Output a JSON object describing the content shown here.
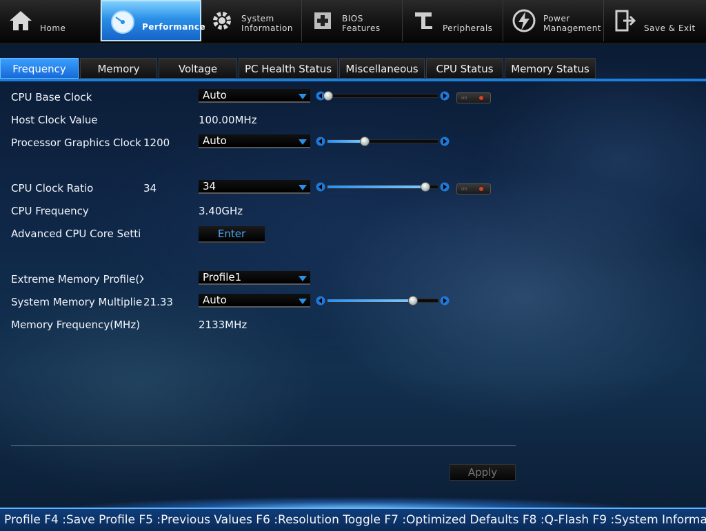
{
  "topnav": {
    "items": [
      {
        "label": "Home",
        "icon": "house-icon"
      },
      {
        "label": "Performance",
        "icon": "gauge-icon",
        "active": true
      },
      {
        "label": "System\nInformation",
        "icon": "gear-icon"
      },
      {
        "label": "BIOS\nFeatures",
        "icon": "chip-plus-icon"
      },
      {
        "label": "Peripherals",
        "icon": "connector-icon"
      },
      {
        "label": "Power\nManagement",
        "icon": "power-bolt-icon"
      },
      {
        "label": "Save & Exit",
        "icon": "exit-door-icon"
      }
    ]
  },
  "tabs": [
    "Frequency",
    "Memory",
    "Voltage",
    "PC Health Status",
    "Miscellaneous",
    "CPU Status",
    "Memory Status"
  ],
  "active_tab": "Frequency",
  "rows": {
    "cpu_base_clock": {
      "label": "CPU Base Clock",
      "dropdown": "Auto",
      "slider_fraction": 0.0,
      "toggle": "off"
    },
    "host_clock": {
      "label": "Host Clock Value",
      "value": "100.00MHz"
    },
    "igpu_clock": {
      "label": "Processor Graphics Clock",
      "current": "1200",
      "dropdown": "Auto",
      "slider_fraction": 0.33
    },
    "cpu_clock_ratio": {
      "label": "CPU Clock Ratio",
      "current": "34",
      "dropdown": "34",
      "slider_fraction": 0.88,
      "toggle": "off"
    },
    "cpu_frequency": {
      "label": "CPU Frequency",
      "value": "3.40GHz"
    },
    "adv_cpu": {
      "label": "Advanced CPU Core Setti",
      "button": "Enter"
    },
    "xmp": {
      "label": "Extreme Memory Profile(X",
      "dropdown": "Profile1"
    },
    "mem_multiplier": {
      "label": "System Memory Multiplie",
      "current": "21.33",
      "dropdown": "Auto",
      "slider_fraction": 0.77
    },
    "mem_freq": {
      "label": "Memory Frequency(MHz)",
      "value": "2133MHz"
    }
  },
  "toggle_off_text": "on",
  "apply_label": "Apply",
  "status_text": "Profile F4 :Save Profile F5 :Previous Values F6 :Resolution Toggle F7 :Optimized Defaults F8 :Q-Flash F9 :System Informa",
  "colors": {
    "accent": "#1c7fe0",
    "active_tab": "#2a8fe6",
    "enter_text": "#48a8ff"
  }
}
